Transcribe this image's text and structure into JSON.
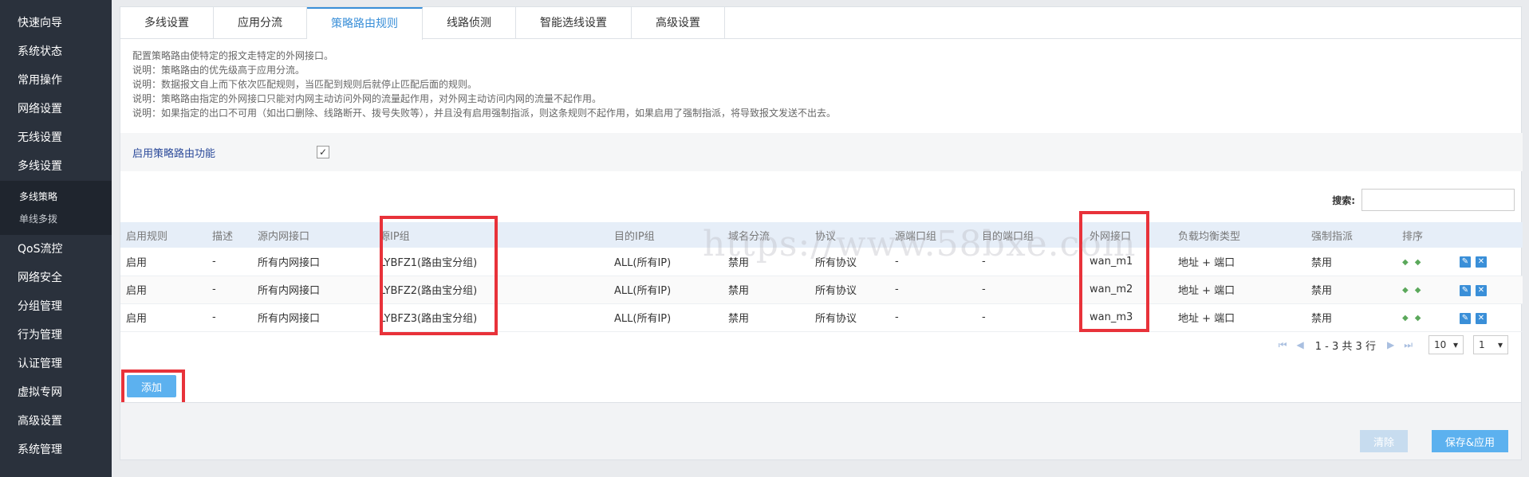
{
  "sidebar": {
    "items_top": [
      {
        "label": "快速向导"
      },
      {
        "label": "系统状态"
      },
      {
        "label": "常用操作"
      },
      {
        "label": "网络设置"
      },
      {
        "label": "无线设置"
      },
      {
        "label": "多线设置"
      }
    ],
    "subitems": [
      {
        "label": "多线策略"
      },
      {
        "label": "单线多拨"
      }
    ],
    "items_bottom": [
      {
        "label": "QoS流控"
      },
      {
        "label": "网络安全"
      },
      {
        "label": "分组管理"
      },
      {
        "label": "行为管理"
      },
      {
        "label": "认证管理"
      },
      {
        "label": "虚拟专网"
      },
      {
        "label": "高级设置"
      },
      {
        "label": "系统管理"
      }
    ]
  },
  "tabs": [
    {
      "label": "多线设置"
    },
    {
      "label": "应用分流"
    },
    {
      "label": "策略路由规则"
    },
    {
      "label": "线路侦测"
    },
    {
      "label": "智能选线设置"
    },
    {
      "label": "高级设置"
    }
  ],
  "notes": [
    "配置策略路由使特定的报文走特定的外网接口。",
    "说明：策略路由的优先级高于应用分流。",
    "说明：数据报文自上而下依次匹配规则，当匹配到规则后就停止匹配后面的规则。",
    "说明：策略路由指定的外网接口只能对内网主动访问外网的流量起作用，对外网主动访问内网的流量不起作用。",
    "说明：如果指定的出口不可用（如出口删除、线路断开、拨号失败等），并且没有启用强制指派，则这条规则不起作用，如果启用了强制指派，将导致报文发送不出去。"
  ],
  "enable": {
    "label": "启用策略路由功能",
    "check": "✓"
  },
  "search": {
    "label": "搜索:",
    "placeholder": ""
  },
  "table": {
    "headers": [
      "启用规则",
      "描述",
      "源内网接口",
      "源IP组",
      "目的IP组",
      "域名分流",
      "协议",
      "源端口组",
      "目的端口组",
      "外网接口",
      "负载均衡类型",
      "强制指派",
      "排序"
    ],
    "rows": [
      {
        "cells": [
          "启用",
          "-",
          "所有内网接口",
          "LYBFZ1(路由宝分组)",
          "ALL(所有IP)",
          "禁用",
          "所有协议",
          "-",
          "-",
          "wan_m1",
          "地址 + 端口",
          "禁用"
        ]
      },
      {
        "cells": [
          "启用",
          "-",
          "所有内网接口",
          "LYBFZ2(路由宝分组)",
          "ALL(所有IP)",
          "禁用",
          "所有协议",
          "-",
          "-",
          "wan_m2",
          "地址 + 端口",
          "禁用"
        ]
      },
      {
        "cells": [
          "启用",
          "-",
          "所有内网接口",
          "LYBFZ3(路由宝分组)",
          "ALL(所有IP)",
          "禁用",
          "所有协议",
          "-",
          "-",
          "wan_m3",
          "地址 + 端口",
          "禁用"
        ]
      }
    ]
  },
  "pager": {
    "summary": "1 - 3 共 3 行",
    "page_size": "10",
    "page": "1"
  },
  "buttons": {
    "add": "添加",
    "clear": "清除",
    "save": "保存&应用"
  },
  "watermark": "https://www.58bxe.com",
  "colors": {
    "accent": "#3a8fd8",
    "highlight": "#e8323a",
    "sidebar_bg": "#2a313c"
  }
}
